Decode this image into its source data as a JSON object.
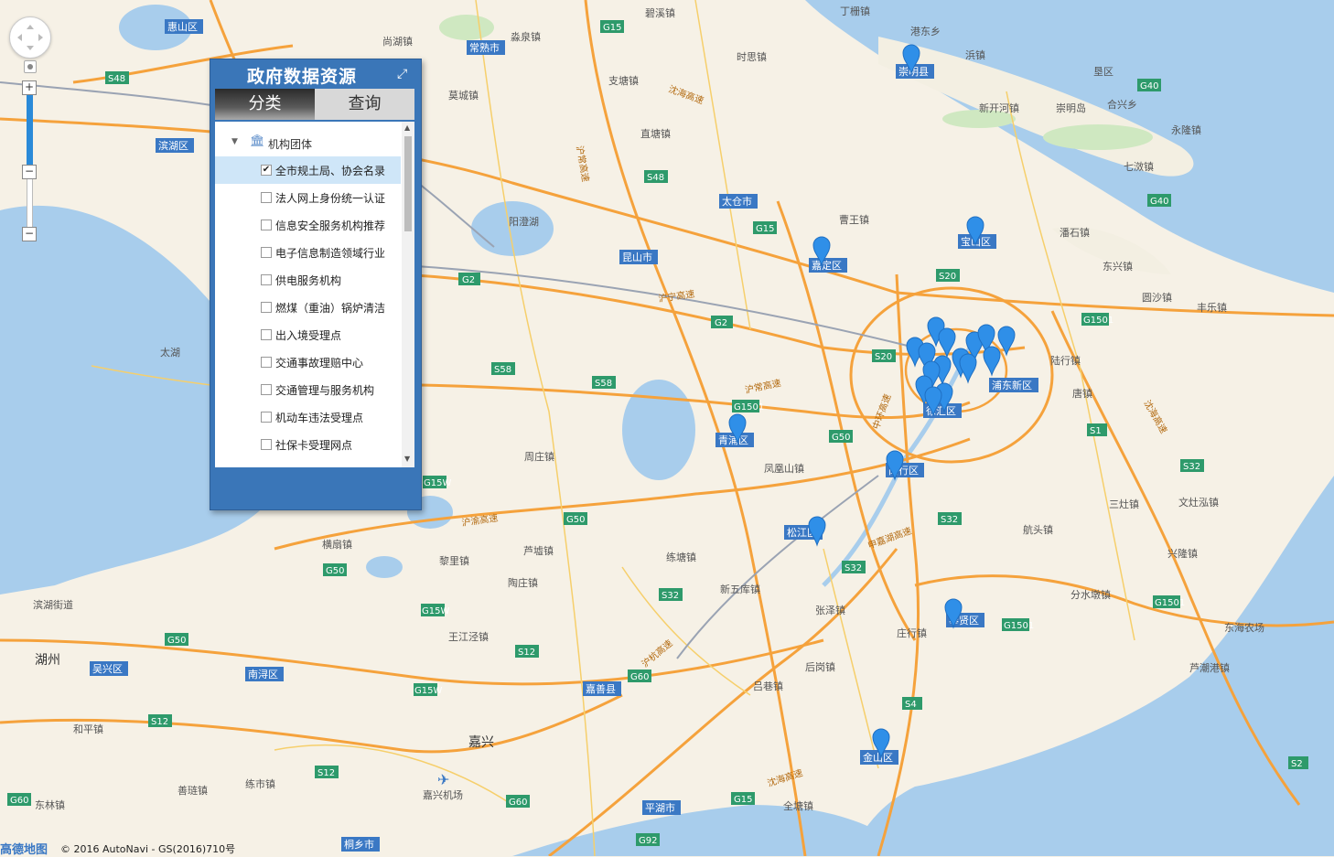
{
  "panel": {
    "title": "政府数据资源",
    "tabs": [
      {
        "label": "分类"
      },
      {
        "label": "查询"
      }
    ],
    "root_label": "机构团体",
    "items": [
      {
        "label": "全市规土局、协会名录",
        "checked": true
      },
      {
        "label": "法人网上身份统一认证",
        "checked": false
      },
      {
        "label": "信息安全服务机构推荐",
        "checked": false
      },
      {
        "label": "电子信息制造领域行业",
        "checked": false
      },
      {
        "label": "供电服务机构",
        "checked": false
      },
      {
        "label": "燃煤（重油）锅炉清洁",
        "checked": false
      },
      {
        "label": "出入境受理点",
        "checked": false
      },
      {
        "label": "交通事故理赔中心",
        "checked": false
      },
      {
        "label": "交通管理与服务机构",
        "checked": false
      },
      {
        "label": "机动车违法受理点",
        "checked": false
      },
      {
        "label": "社保卡受理网点",
        "checked": false
      }
    ]
  },
  "map": {
    "districts": [
      "惠山区",
      "常熟市",
      "滨湖区",
      "太仓市",
      "昆山市",
      "崇明县",
      "宝山区",
      "嘉定区",
      "青浦区",
      "浦东新区",
      "徐汇区",
      "闵行区",
      "松江区",
      "奉贤区",
      "金山区",
      "吴兴区",
      "南浔区",
      "嘉善县",
      "平湖市",
      "桐乡市"
    ],
    "big_places": [
      "湖州",
      "嘉兴"
    ],
    "towns": [
      "碧溪镇",
      "丁栅镇",
      "港东乡",
      "浜镇",
      "淼泉镇",
      "尚湖镇",
      "时思镇",
      "莫城镇",
      "支塘镇",
      "直塘镇",
      "阳澄湖",
      "曹王镇",
      "新开河镇",
      "崇明岛",
      "合兴乡",
      "垦区",
      "永隆镇",
      "七滧镇",
      "潘石镇",
      "东兴镇",
      "圆沙镇",
      "丰乐镇",
      "陆行镇",
      "唐镇",
      "三灶镇",
      "文灶泓镇",
      "航头镇",
      "兴隆镇",
      "分水墩镇",
      "东海农场",
      "芦潮港镇",
      "庄行镇",
      "后岗镇",
      "吕巷镇",
      "全塘镇",
      "张泽镇",
      "新五库镇",
      "练塘镇",
      "凤凰山镇",
      "周庄镇",
      "横扇镇",
      "黎里镇",
      "芦墟镇",
      "陶庄镇",
      "王江泾镇",
      "和平镇",
      "练市镇",
      "善琏镇",
      "东林镇",
      "滨湖街道",
      "太湖",
      "嘉兴机场"
    ],
    "highways": [
      "G15",
      "G40",
      "S48",
      "G2",
      "S58",
      "S20",
      "G1501",
      "S1",
      "S32",
      "G50",
      "G60",
      "S4",
      "S12",
      "G15W",
      "G92",
      "S2",
      "沪宁高速",
      "沪渝高速",
      "沪常高速",
      "沪杭高速",
      "沈海高速",
      "中环高速",
      "申嘉湖高速"
    ],
    "marker_color": "#2f8fe8",
    "water_color": "#a8cdec",
    "road_color": "#f5a23c"
  },
  "footer": {
    "logo": "高德地图",
    "copyright": "© 2016 AutoNavi - GS(2016)710号"
  }
}
